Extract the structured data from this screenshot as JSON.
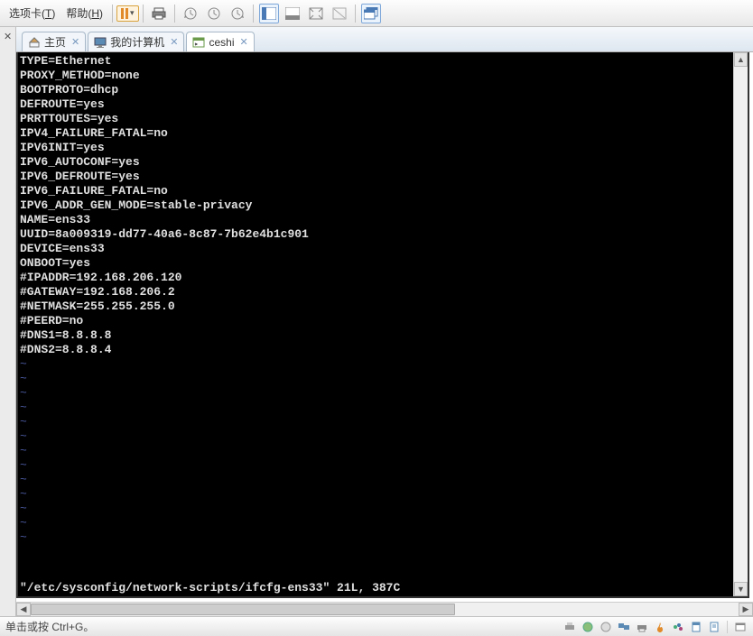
{
  "toolbar": {
    "menu_options_prefix": "选项卡(",
    "menu_options_hotkey": "T",
    "menu_options_suffix": ")",
    "menu_help_prefix": "帮助(",
    "menu_help_hotkey": "H",
    "menu_help_suffix": ")"
  },
  "tabs": [
    {
      "label": "主页"
    },
    {
      "label": "我的计算机"
    },
    {
      "label": "ceshi"
    }
  ],
  "terminal": {
    "lines": [
      "TYPE=Ethernet",
      "PROXY_METHOD=none",
      "BOOTPROTO=dhcp",
      "DEFROUTE=yes",
      "PRRTTOUTES=yes",
      "IPV4_FAILURE_FATAL=no",
      "IPV6INIT=yes",
      "IPV6_AUTOCONF=yes",
      "IPV6_DEFROUTE=yes",
      "IPV6_FAILURE_FATAL=no",
      "IPV6_ADDR_GEN_MODE=stable-privacy",
      "NAME=ens33",
      "UUID=8a009319-dd77-40a6-8c87-7b62e4b1c901",
      "DEVICE=ens33",
      "ONBOOT=yes",
      "#IPADDR=192.168.206.120",
      "#GATEWAY=192.168.206.2",
      "#NETMASK=255.255.255.0",
      "#PEERD=no",
      "#DNS1=8.8.8.8",
      "#DNS2=8.8.8.4"
    ],
    "tilde_count": 13,
    "status_line": "\"/etc/sysconfig/network-scripts/ifcfg-ens33\" 21L, 387C"
  },
  "statusbar": {
    "text": "单击或按 Ctrl+G。"
  },
  "colors": {
    "terminal_bg": "#000000",
    "terminal_fg": "#e0e0e0",
    "tilde": "#4a5aa0"
  }
}
